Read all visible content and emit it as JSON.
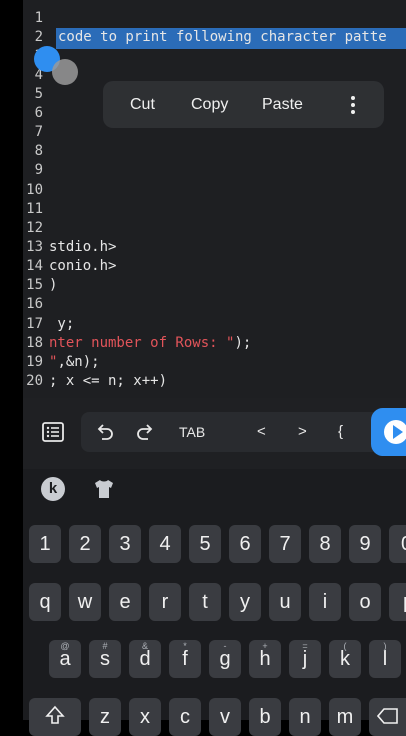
{
  "editor": {
    "lines": [
      {
        "n": "1",
        "text": ""
      },
      {
        "n": "2",
        "text": "code to print following character patte"
      },
      {
        "n": "3",
        "text": ""
      },
      {
        "n": "4",
        "text": ""
      },
      {
        "n": "5",
        "text": ""
      },
      {
        "n": "6",
        "text": ""
      },
      {
        "n": "7",
        "text": ""
      },
      {
        "n": "8",
        "text": ""
      },
      {
        "n": "9",
        "text": ""
      },
      {
        "n": "10",
        "text": ""
      },
      {
        "n": "11",
        "text": ""
      },
      {
        "n": "12",
        "text": ""
      },
      {
        "n": "13",
        "text": "stdio.h>"
      },
      {
        "n": "14",
        "text": "conio.h>"
      },
      {
        "n": "15",
        "text": ")"
      },
      {
        "n": "16",
        "text": ""
      },
      {
        "n": "17",
        "text": " y;"
      },
      {
        "n": "18",
        "text_red": "nter number of Rows: \"",
        "text_rest": ");"
      },
      {
        "n": "19",
        "text_red": "\"",
        "text_rest": ",&n);"
      },
      {
        "n": "20",
        "text": "; x <= n; x++)"
      }
    ]
  },
  "context_menu": {
    "cut": "Cut",
    "copy": "Copy",
    "paste": "Paste",
    "more_icon": "more-vert-icon"
  },
  "toolbar": {
    "list_icon": "list-icon",
    "undo_icon": "undo-icon",
    "redo_icon": "redo-icon",
    "tab": "TAB",
    "lt": "<",
    "gt": ">",
    "brace": "{",
    "run_icon": "play-icon",
    "run_color": "#2f8ef0"
  },
  "keyboard": {
    "top_icons": {
      "k": "k",
      "shirt": "shirt-icon"
    },
    "numbers": [
      "1",
      "2",
      "3",
      "4",
      "5",
      "6",
      "7",
      "8",
      "9",
      "0"
    ],
    "row1": [
      "q",
      "w",
      "e",
      "r",
      "t",
      "y",
      "u",
      "i",
      "o",
      "p"
    ],
    "row2": [
      {
        "k": "a",
        "s": "@"
      },
      {
        "k": "s",
        "s": "#"
      },
      {
        "k": "d",
        "s": "&"
      },
      {
        "k": "f",
        "s": "*"
      },
      {
        "k": "g",
        "s": "-"
      },
      {
        "k": "h",
        "s": "+"
      },
      {
        "k": "j",
        "s": "="
      },
      {
        "k": "k",
        "s": "("
      },
      {
        "k": "l",
        "s": ")"
      }
    ],
    "row3": [
      "z",
      "x",
      "c",
      "v",
      "b",
      "n",
      "m"
    ],
    "shift_icon": "shift-icon",
    "backspace_icon": "backspace-icon"
  },
  "colors": {
    "accent": "#2f8ef0",
    "selection": "#2b6cb8",
    "string": "#e2545a"
  }
}
